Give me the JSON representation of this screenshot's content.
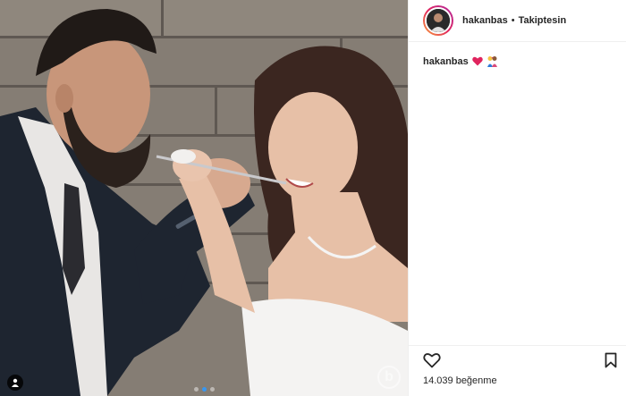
{
  "post": {
    "username": "hakanbas",
    "separator": "•",
    "follow_state": "Takiptesin",
    "caption_username": "hakanbas",
    "caption_emojis": [
      "red-heart",
      "couple-kiss"
    ],
    "likes_text": "14.039 beğenme",
    "carousel": {
      "count": 3,
      "active_index": 1
    },
    "photo_watermark": "b"
  },
  "icons": {
    "like": "heart-outline-icon",
    "save": "bookmark-outline-icon",
    "tag": "person-tag-icon"
  },
  "colors": {
    "accent": "#3897f0",
    "heart": "#e0245e",
    "border": "#efefef",
    "text": "#262626"
  }
}
